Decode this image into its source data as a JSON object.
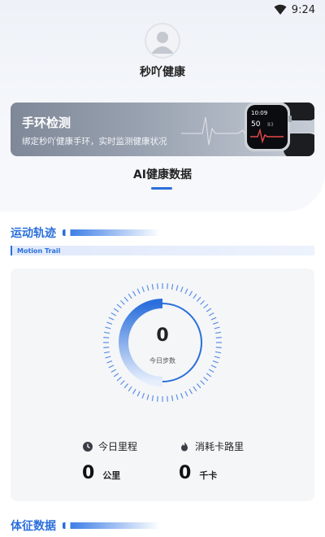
{
  "status_bar": {
    "time": "9:24"
  },
  "profile": {
    "app_name": "秒吖健康"
  },
  "band_card": {
    "title": "手环检测",
    "subtitle": "绑定秒吖健康手环，实时监测健康状况",
    "watch_screen": {
      "time": "10:09",
      "value": "50",
      "sub_value": "83"
    }
  },
  "ai_section": {
    "title": "AI健康数据"
  },
  "motion": {
    "title": "运动轨迹",
    "subtitle": "Motion Trail",
    "steps_value": "0",
    "steps_label": "今日步数",
    "steps_progress": 0,
    "distance_label": "今日里程",
    "distance_value": "0",
    "distance_unit": "公里",
    "calories_label": "消耗卡路里",
    "calories_value": "0",
    "calories_unit": "千卡"
  },
  "vitals": {
    "title": "体征数据"
  },
  "colors": {
    "accent": "#2a6fdb",
    "card_bg": "#f5f6f8",
    "band_card": "#8a93a2"
  }
}
